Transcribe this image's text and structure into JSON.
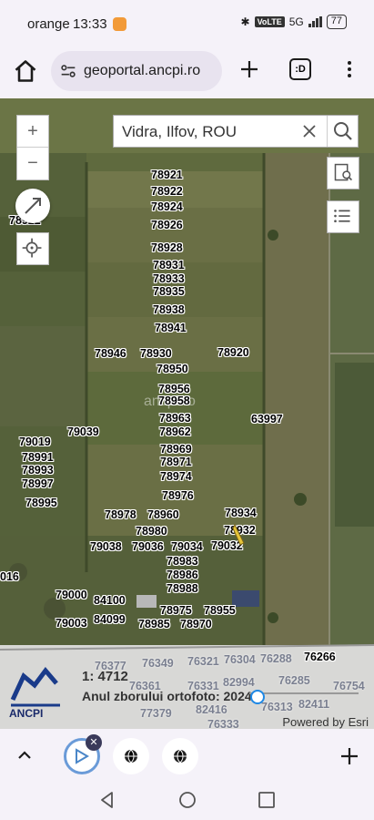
{
  "status": {
    "carrier": "orange",
    "time": "13:33",
    "volte": "VoLTE",
    "network": "5G",
    "battery": "77"
  },
  "browser": {
    "url": "geoportal.ancpi.ro",
    "tabs_label": ":D"
  },
  "map": {
    "search": {
      "value": "Vidra, Ilfov, ROU"
    },
    "watermark": "ancpi.ro",
    "scale": "1: 4712",
    "year_label": "Anul zborului ortofoto: 2024",
    "attribution": "Powered by Esri",
    "logo_text": "ANCPI",
    "year_slider_position": 0.08,
    "parcels": [
      "78921",
      "78922",
      "78924",
      "78926",
      "78928",
      "78931",
      "78933",
      "78935",
      "78938",
      "78941",
      "78946",
      "78930",
      "78920",
      "78950",
      "78956",
      "78958",
      "78963",
      "78962",
      "63997",
      "79039",
      "79019",
      "78991",
      "78993",
      "78997",
      "78969",
      "78971",
      "78974",
      "78976",
      "78995",
      "78978",
      "78960",
      "78934",
      "78980",
      "78932",
      "79038",
      "79036",
      "79034",
      "79032",
      "78983",
      "78986",
      "78988",
      "79000",
      "84100",
      "84099",
      "79003",
      "78975",
      "78955",
      "78985",
      "78970",
      "016",
      "78922"
    ],
    "faint_parcels": [
      "76377",
      "76349",
      "76321",
      "76304",
      "76288",
      "76266",
      "76361",
      "76331",
      "82994",
      "76285",
      "76754",
      "77379",
      "82416",
      "76313",
      "82411",
      "76333"
    ]
  },
  "colors": {
    "accent": "#1e88e5",
    "chrome_bg": "#f5f2f9"
  }
}
